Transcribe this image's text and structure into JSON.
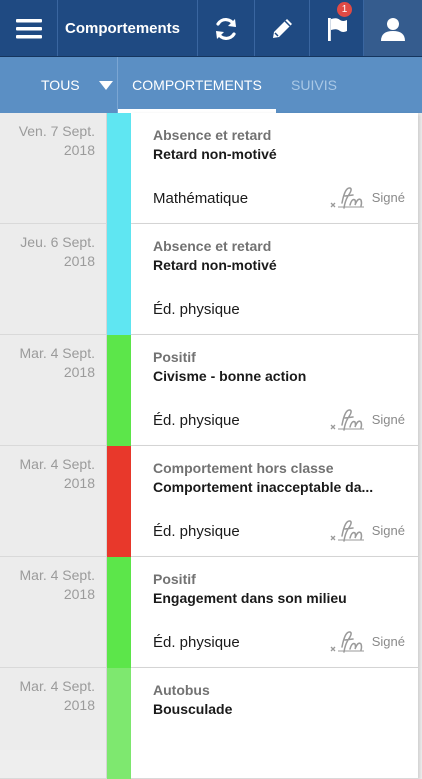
{
  "header": {
    "title": "Comportements",
    "notification_count": "1"
  },
  "tabs": {
    "filter_label": "TOUS",
    "items": [
      {
        "label": "COMPORTEMENTS",
        "active": true
      },
      {
        "label": "SUIVIS",
        "active": false
      }
    ]
  },
  "entries": [
    {
      "date_line1": "Ven. 7 Sept.",
      "date_line2": "2018",
      "color": "#5fe6f2",
      "category": "Absence et retard",
      "title": "Retard non-motivé",
      "subject": "Mathématique",
      "signed_label": "Signé",
      "signed": true
    },
    {
      "date_line1": "Jeu. 6 Sept.",
      "date_line2": "2018",
      "color": "#5fe6f2",
      "category": "Absence et retard",
      "title": "Retard non-motivé",
      "subject": "Éd. physique",
      "signed_label": "",
      "signed": false
    },
    {
      "date_line1": "Mar. 4 Sept.",
      "date_line2": "2018",
      "color": "#5ce64a",
      "category": "Positif",
      "title": "Civisme - bonne action",
      "subject": "Éd. physique",
      "signed_label": "Signé",
      "signed": true
    },
    {
      "date_line1": "Mar. 4 Sept.",
      "date_line2": "2018",
      "color": "#e8382b",
      "category": "Comportement hors classe",
      "title": "Comportement inacceptable da...",
      "subject": "Éd. physique",
      "signed_label": "Signé",
      "signed": true
    },
    {
      "date_line1": "Mar. 4 Sept.",
      "date_line2": "2018",
      "color": "#5ce64a",
      "category": "Positif",
      "title": "Engagement dans son milieu",
      "subject": "Éd. physique",
      "signed_label": "Signé",
      "signed": true
    },
    {
      "date_line1": "Mar. 4 Sept.",
      "date_line2": "2018",
      "color": "#7ee86f",
      "category": "Autobus",
      "title": "Bousculade",
      "subject": "",
      "signed_label": "",
      "signed": false
    }
  ]
}
